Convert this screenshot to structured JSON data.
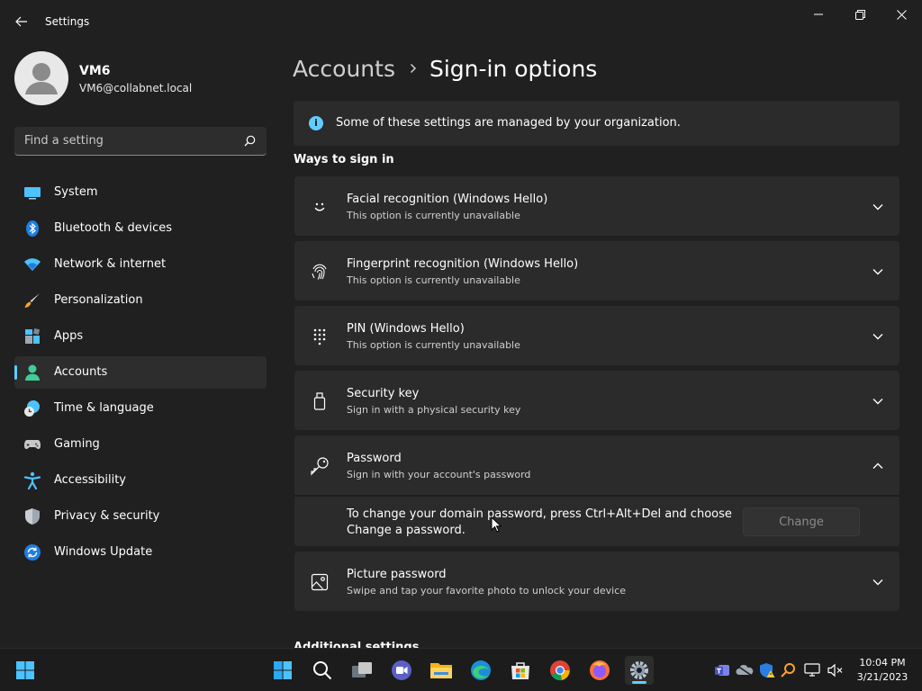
{
  "app": {
    "title": "Settings",
    "window_controls": [
      "minimize",
      "maximize",
      "close"
    ]
  },
  "profile": {
    "name": "VM6",
    "email": "VM6@collabnet.local"
  },
  "search": {
    "placeholder": "Find a setting"
  },
  "sidebar": {
    "items": [
      {
        "label": "System",
        "icon": "system-icon"
      },
      {
        "label": "Bluetooth & devices",
        "icon": "bluetooth-icon"
      },
      {
        "label": "Network & internet",
        "icon": "wifi-icon"
      },
      {
        "label": "Personalization",
        "icon": "brush-icon"
      },
      {
        "label": "Apps",
        "icon": "apps-icon"
      },
      {
        "label": "Accounts",
        "icon": "accounts-icon",
        "active": true
      },
      {
        "label": "Time & language",
        "icon": "clock-globe-icon"
      },
      {
        "label": "Gaming",
        "icon": "gamepad-icon"
      },
      {
        "label": "Accessibility",
        "icon": "accessibility-icon"
      },
      {
        "label": "Privacy & security",
        "icon": "shield-icon"
      },
      {
        "label": "Windows Update",
        "icon": "update-icon"
      }
    ]
  },
  "breadcrumb": {
    "parent": "Accounts",
    "current": "Sign-in options"
  },
  "info_bar": {
    "text": "Some of these settings are managed by your organization."
  },
  "section": {
    "title": "Ways to sign in",
    "next_title": "Additional settings"
  },
  "options": [
    {
      "title": "Facial recognition (Windows Hello)",
      "subtitle": "This option is currently unavailable",
      "icon": "face-icon",
      "expanded": false
    },
    {
      "title": "Fingerprint recognition (Windows Hello)",
      "subtitle": "This option is currently unavailable",
      "icon": "fingerprint-icon",
      "expanded": false
    },
    {
      "title": "PIN (Windows Hello)",
      "subtitle": "This option is currently unavailable",
      "icon": "pin-keypad-icon",
      "expanded": false
    },
    {
      "title": "Security key",
      "subtitle": "Sign in with a physical security key",
      "icon": "usb-key-icon",
      "expanded": false
    },
    {
      "title": "Password",
      "subtitle": "Sign in with your account's password",
      "icon": "key-icon",
      "expanded": true
    },
    {
      "title": "Picture password",
      "subtitle": "Swipe and tap your favorite photo to unlock your device",
      "icon": "picture-icon",
      "expanded": false
    }
  ],
  "password_detail": {
    "text": "To change your domain password, press Ctrl+Alt+Del and choose Change a password.",
    "button_label": "Change"
  },
  "taskbar": {
    "apps": [
      "start-icon",
      "search-icon",
      "task-view-icon",
      "teams-chat-icon",
      "file-explorer-icon",
      "edge-icon",
      "store-icon",
      "chrome-icon",
      "firefox-icon",
      "settings-icon"
    ],
    "active_app": "settings-icon",
    "tray": [
      "teams-icon",
      "onedrive-icon",
      "defender-icon",
      "search-tool-icon",
      "network-icon",
      "volume-muted-icon"
    ],
    "time": "10:04 PM",
    "date": "3/21/2023"
  },
  "colors": {
    "accent": "#60cdff",
    "background": "#202020",
    "card": "#2b2b2b",
    "taskbar": "#1c1c1c"
  }
}
